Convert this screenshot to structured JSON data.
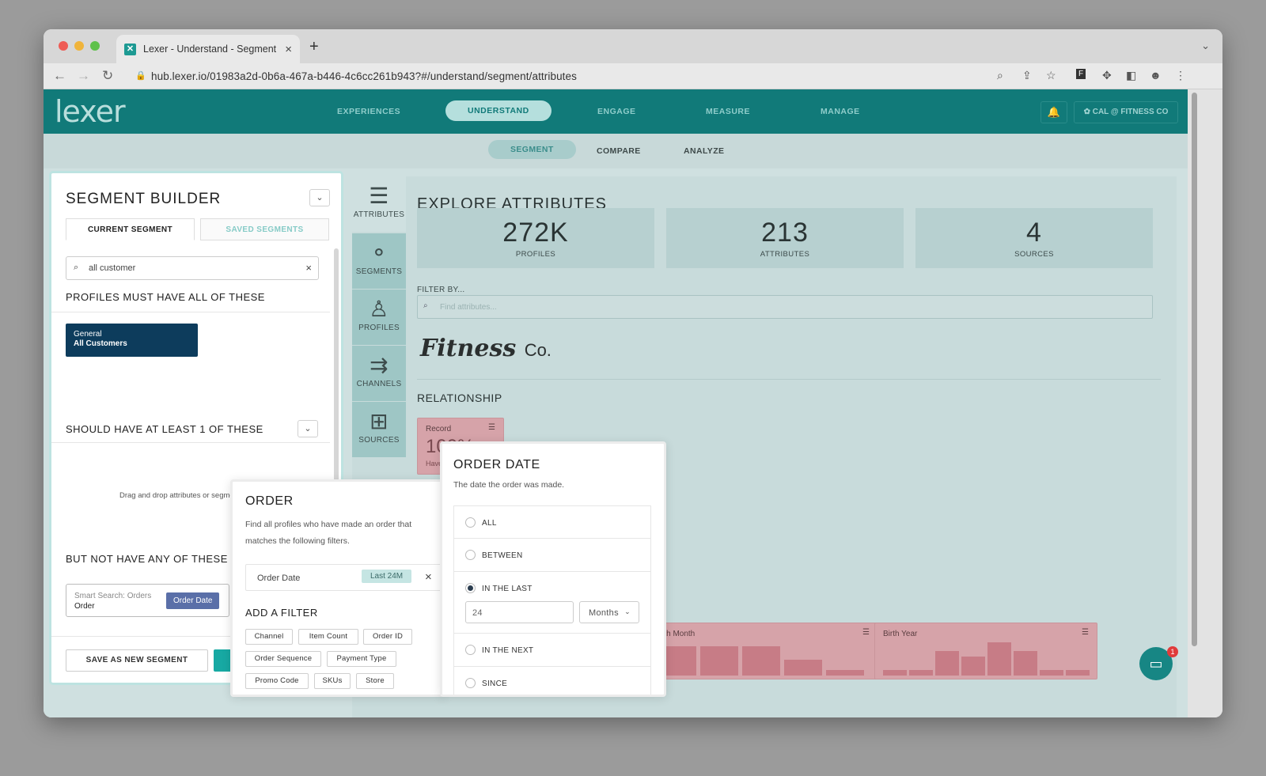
{
  "browser": {
    "tab_title": "Lexer - Understand - Segment",
    "url": "hub.lexer.io/01983a2d-0b6a-467a-b446-4c6cc261b943?#/understand/segment/attributes"
  },
  "app": {
    "logo": "lexer",
    "nav": [
      "EXPERIENCES",
      "UNDERSTAND",
      "ENGAGE",
      "MEASURE",
      "MANAGE"
    ],
    "active_nav": "UNDERSTAND",
    "account": "CAL @ FITNESS CO",
    "subnav": [
      "SEGMENT",
      "COMPARE",
      "ANALYZE"
    ],
    "active_subnav": "SEGMENT"
  },
  "segment_builder": {
    "title": "SEGMENT BUILDER",
    "tabs": [
      "CURRENT SEGMENT",
      "SAVED SEGMENTS"
    ],
    "search_value": "all customer",
    "must_have": "PROFILES MUST HAVE ALL OF THESE",
    "chip_line1": "General",
    "chip_line2": "All Customers",
    "should_have": "SHOULD HAVE AT LEAST 1 OF THESE",
    "drag_text": "Drag and drop attributes or segme",
    "but_not": "BUT NOT HAVE ANY OF THESE",
    "smart_search": "Smart Search: Orders",
    "smart_sub": "Order",
    "smart_tag": "Order Date",
    "save_button": "SAVE AS NEW SEGMENT"
  },
  "explore": {
    "icons": [
      {
        "label": "ATTRIBUTES",
        "icon": "list-icon"
      },
      {
        "label": "SEGMENTS",
        "icon": "segments-icon"
      },
      {
        "label": "PROFILES",
        "icon": "person-icon"
      },
      {
        "label": "CHANNELS",
        "icon": "channels-icon"
      },
      {
        "label": "SOURCES",
        "icon": "sources-icon"
      }
    ],
    "title": "EXPLORE ATTRIBUTES",
    "stats": [
      {
        "value": "272K",
        "label": "PROFILES"
      },
      {
        "value": "213",
        "label": "ATTRIBUTES"
      },
      {
        "value": "4",
        "label": "SOURCES"
      }
    ],
    "filter_label": "FILTER BY...",
    "filter_placeholder": "Find attributes...",
    "brand": "Fitness",
    "brand_suffix": "Co.",
    "section": "RELATIONSHIP",
    "record_card": {
      "title": "Record",
      "value": "100%",
      "sub": "Have"
    },
    "cards": [
      {
        "title": "rth Month",
        "bars": [
          0.85,
          0.85,
          0.85,
          0.45,
          0.15
        ]
      },
      {
        "title": "Birth Year",
        "bars": [
          0.15,
          0.15,
          0.7,
          0.55,
          0.95,
          0.7,
          0.15,
          0.15
        ]
      }
    ]
  },
  "order_popup": {
    "title": "ORDER",
    "desc": "Find all profiles who have made an order that matches the following filters.",
    "row_label": "Order Date",
    "row_tag": "Last 24M",
    "add_filter": "ADD A FILTER",
    "filters": [
      "Channel",
      "Item Count",
      "Order ID",
      "Order Sequence",
      "Payment Type",
      "Promo Code",
      "SKUs",
      "Store"
    ]
  },
  "date_popup": {
    "title": "ORDER DATE",
    "desc": "The date the order was made.",
    "options": [
      "ALL",
      "BETWEEN",
      "IN THE LAST",
      "IN THE NEXT",
      "SINCE"
    ],
    "selected": "IN THE LAST",
    "number": "24",
    "unit": "Months"
  },
  "chat_badge": "1"
}
